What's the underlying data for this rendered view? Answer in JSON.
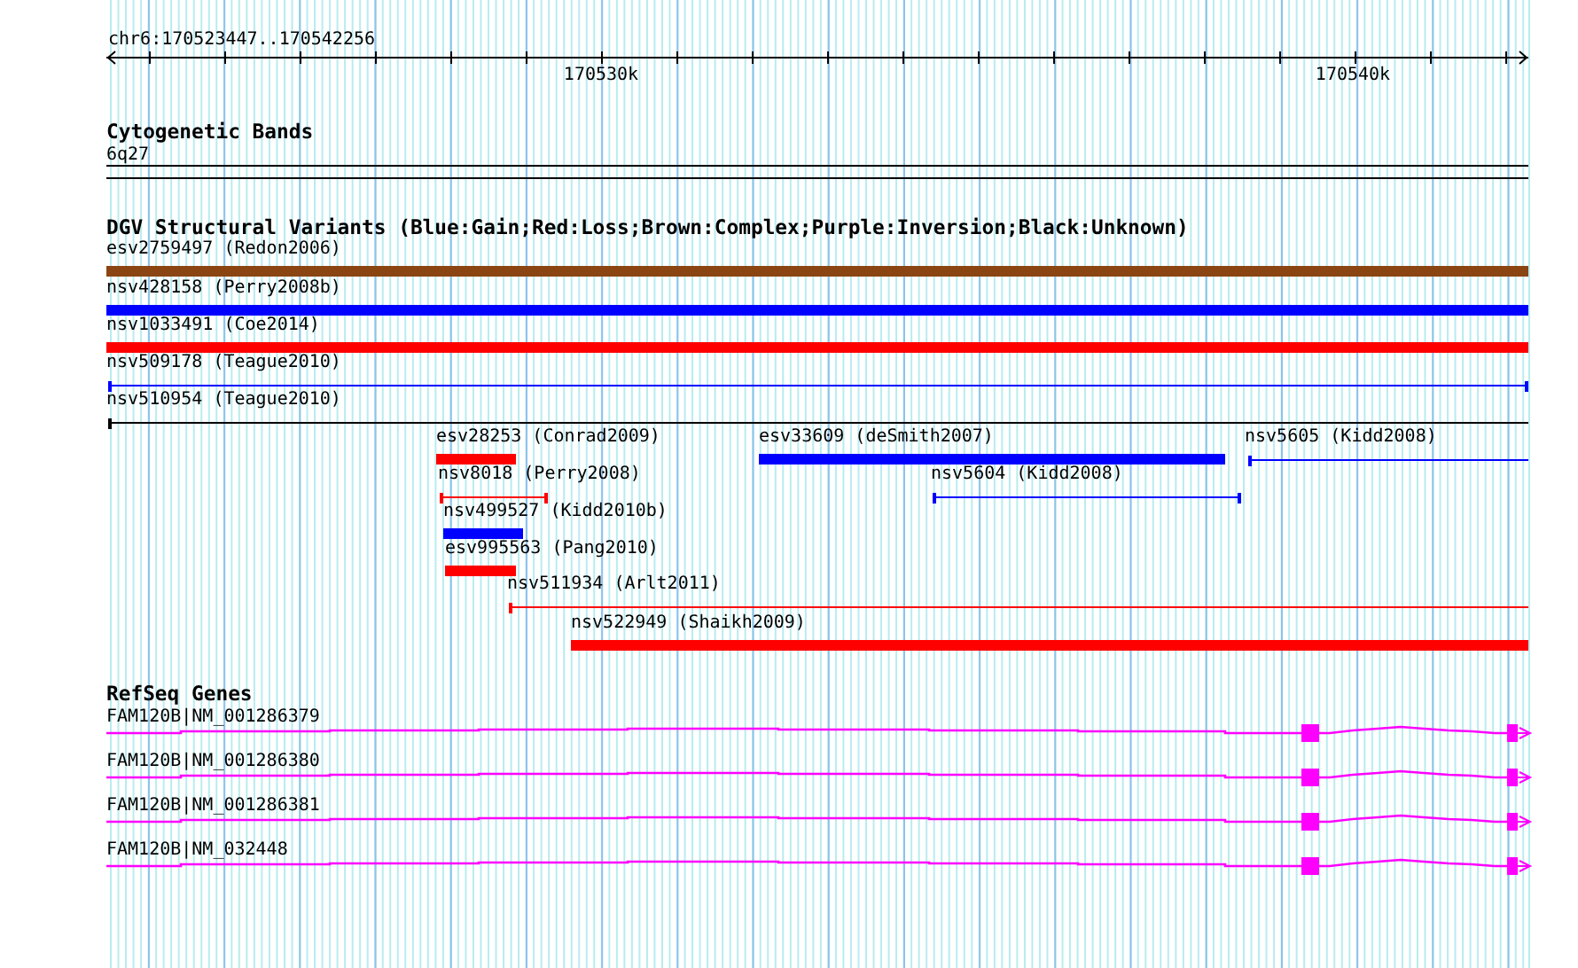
{
  "ruler": {
    "region": "chr6:170523447..170542256",
    "ticks": [
      "170530k",
      "170540k"
    ]
  },
  "cytogenetic_bands": {
    "title": "Cytogenetic Bands",
    "band": "6q27"
  },
  "dgv_variants": {
    "title": "DGV Structural Variants (Blue:Gain;Red:Loss;Brown:Complex;Purple:Inversion;Black:Unknown)",
    "items": [
      {
        "label": "esv2759497 (Redon2006)",
        "kind": "bar",
        "color": "#8b4513"
      },
      {
        "label": "nsv428158 (Perry2008b)",
        "kind": "bar",
        "color": "#0000ff"
      },
      {
        "label": "nsv1033491 (Coe2014)",
        "kind": "bar",
        "color": "#ff0000"
      },
      {
        "label": "nsv509178 (Teague2010)",
        "kind": "span",
        "color": "#0000ff"
      },
      {
        "label": "nsv510954 (Teague2010)",
        "kind": "open",
        "color": "#000000"
      },
      {
        "label": "esv28253 (Conrad2009)",
        "kind": "bar",
        "color": "#ff0000"
      },
      {
        "label": "esv33609 (deSmith2007)",
        "kind": "bar",
        "color": "#0000ff"
      },
      {
        "label": "nsv5605 (Kidd2008)",
        "kind": "open",
        "color": "#0000ff"
      },
      {
        "label": "nsv8018 (Perry2008)",
        "kind": "span",
        "color": "#ff0000"
      },
      {
        "label": "nsv5604 (Kidd2008)",
        "kind": "span",
        "color": "#0000ff"
      },
      {
        "label": "nsv499527 (Kidd2010b)",
        "kind": "bar",
        "color": "#0000ff"
      },
      {
        "label": "esv995563 (Pang2010)",
        "kind": "bar",
        "color": "#ff0000"
      },
      {
        "label": "nsv511934 (Arlt2011)",
        "kind": "open",
        "color": "#ff0000"
      },
      {
        "label": "nsv522949 (Shaikh2009)",
        "kind": "bar",
        "color": "#ff0000"
      }
    ]
  },
  "refseq_genes": {
    "title": "RefSeq Genes",
    "items": [
      {
        "label": "FAM120B|NM_001286379"
      },
      {
        "label": "FAM120B|NM_001286380"
      },
      {
        "label": "FAM120B|NM_001286381"
      },
      {
        "label": "FAM120B|NM_032448"
      }
    ]
  }
}
